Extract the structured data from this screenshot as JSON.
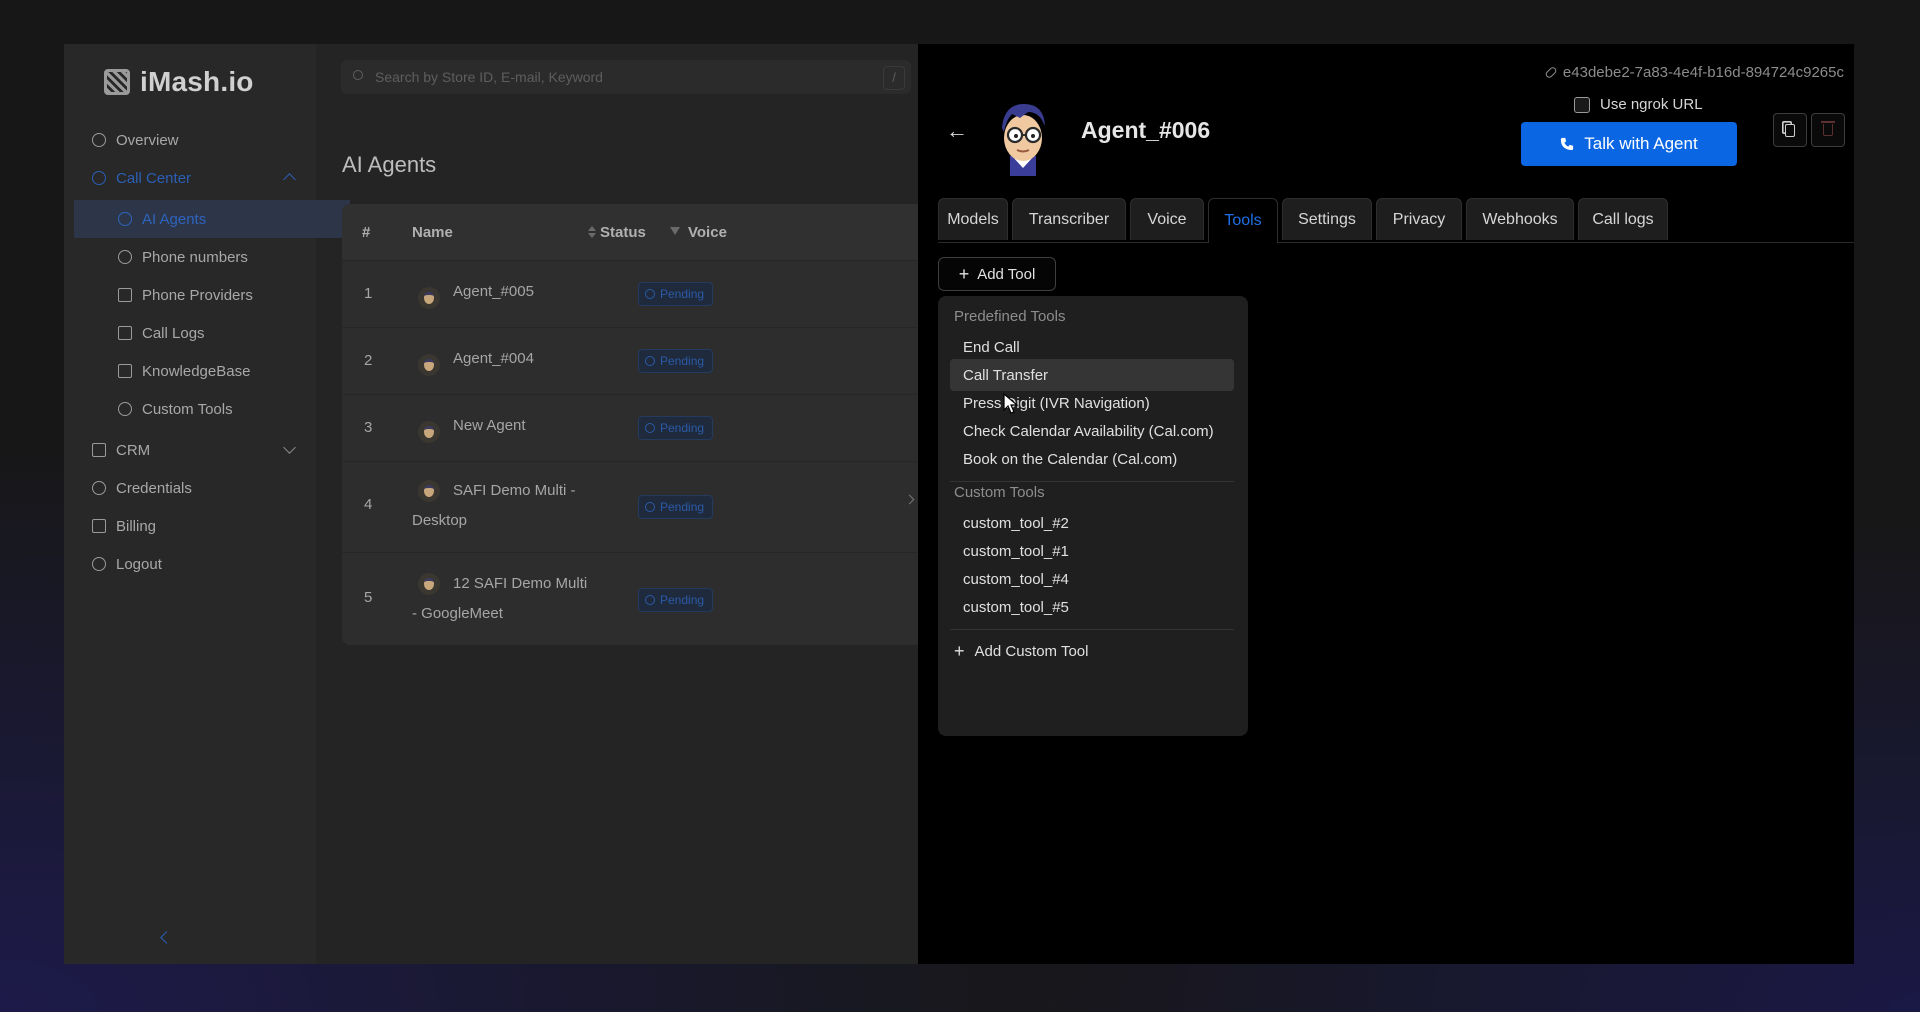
{
  "brand": {
    "name": "iMash.io"
  },
  "search": {
    "placeholder": "Search by Store ID, E-mail, Keyword",
    "shortcut": "/"
  },
  "sidebar": {
    "items": [
      {
        "label": "Overview"
      },
      {
        "label": "Call Center"
      },
      {
        "label": "AI Agents"
      },
      {
        "label": "Phone numbers"
      },
      {
        "label": "Phone Providers"
      },
      {
        "label": "Call Logs"
      },
      {
        "label": "KnowledgeBase"
      },
      {
        "label": "Custom Tools"
      },
      {
        "label": "CRM"
      },
      {
        "label": "Credentials"
      },
      {
        "label": "Billing"
      },
      {
        "label": "Logout"
      }
    ]
  },
  "main": {
    "title": "AI Agents",
    "table": {
      "headers": [
        "#",
        "Name",
        "Status",
        "Voice"
      ],
      "rows": [
        {
          "num": "1",
          "name": "Agent_#005",
          "status": "Pending"
        },
        {
          "num": "2",
          "name": "Agent_#004",
          "status": "Pending"
        },
        {
          "num": "3",
          "name": "New Agent",
          "status": "Pending"
        },
        {
          "num": "4",
          "name": "SAFI Demo Multi - Desktop",
          "status": "Pending"
        },
        {
          "num": "5",
          "name": "12 SAFI Demo Multi - GoogleMeet",
          "status": "Pending"
        }
      ]
    }
  },
  "drawer": {
    "uuid": "e43debe2-7a83-4e4f-b16d-894724c9265c",
    "ngrok_label": "Use ngrok URL",
    "agent_name": "Agent_#006",
    "talk_label": "Talk with Agent",
    "tabs": [
      "Models",
      "Transcriber",
      "Voice",
      "Tools",
      "Settings",
      "Privacy",
      "Webhooks",
      "Call logs"
    ],
    "active_tab": "Tools",
    "add_tool_label": "Add Tool",
    "menu": {
      "predefined_heading": "Predefined Tools",
      "predefined": [
        "End Call",
        "Call Transfer",
        "Press Digit (IVR Navigation)",
        "Check Calendar Availability (Cal.com)",
        "Book on the Calendar (Cal.com)"
      ],
      "custom_heading": "Custom Tools",
      "custom": [
        "custom_tool_#2",
        "custom_tool_#1",
        "custom_tool_#4",
        "custom_tool_#5"
      ],
      "add_custom_label": "Add Custom Tool"
    }
  },
  "colors": {
    "accent": "#0b66e4",
    "active_tab": "#1f6fe6",
    "dim_accent": "#2a5fb5"
  }
}
